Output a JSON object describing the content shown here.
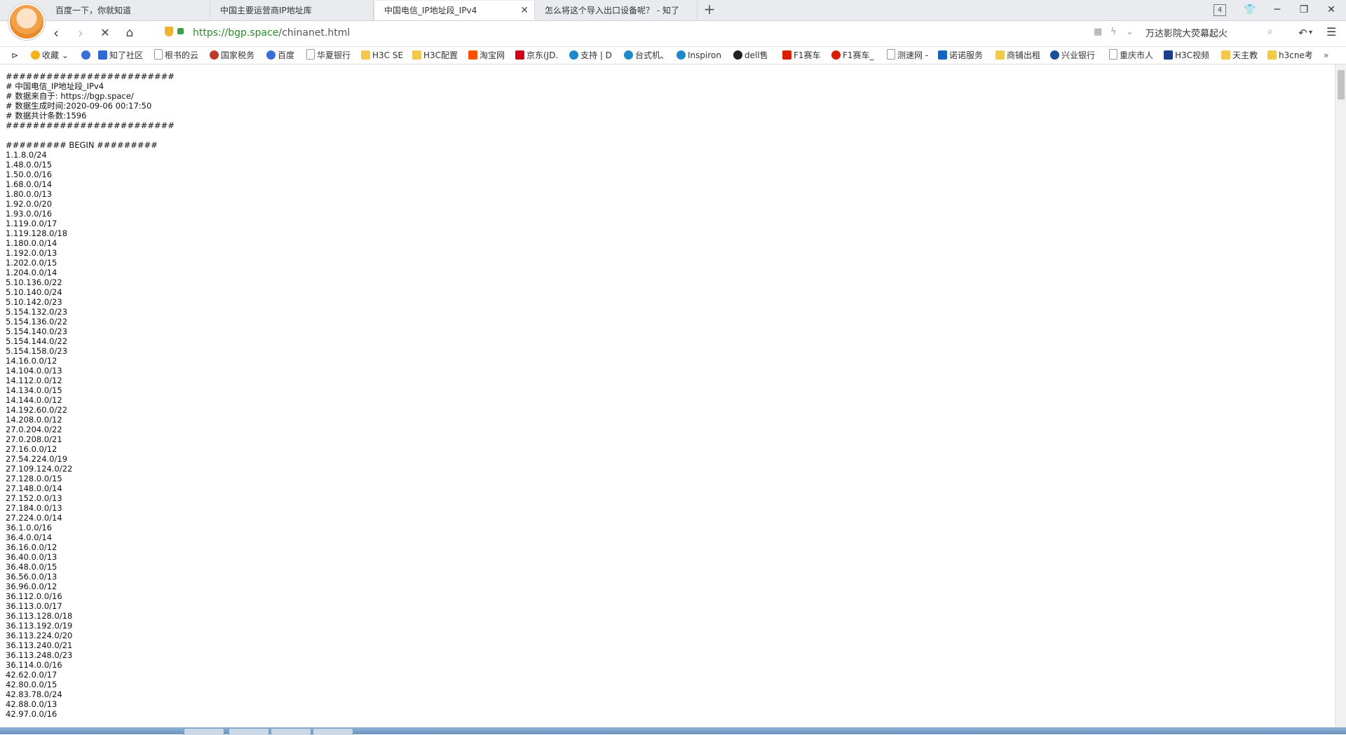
{
  "tabs": [
    {
      "label": "百度一下，你就知道",
      "active": false
    },
    {
      "label": "中国主要运营商IP地址库",
      "active": false
    },
    {
      "label": "中国电信_IP地址段_IPv4",
      "active": true
    },
    {
      "label": "怎么将这个导入出口设备呢？ - 知了",
      "active": false
    }
  ],
  "tab_count": "4",
  "address": {
    "scheme": "https://",
    "host": "bgp.space",
    "path": "/chinanet.html"
  },
  "search": {
    "value": "万达影院大荧幕起火"
  },
  "bookmarks": [
    {
      "label": "收藏",
      "icon": "star-icon",
      "color": "#f2b21b"
    },
    {
      "label": "",
      "icon": "paw-icon",
      "color": "#3a6fd8"
    },
    {
      "label": "知了社区",
      "icon": "zhiliao-icon",
      "color": "#2f6ad0"
    },
    {
      "label": "根书的云",
      "icon": "page-icon",
      "color": "#bbbbbb"
    },
    {
      "label": "国家税务",
      "icon": "tax-icon",
      "color": "#c0392b"
    },
    {
      "label": "百度",
      "icon": "paw-icon",
      "color": "#3a6fd8"
    },
    {
      "label": "华夏银行",
      "icon": "page-icon",
      "color": "#bbbbbb"
    },
    {
      "label": "H3C SE",
      "icon": "folder-icon",
      "color": "#f2c94c"
    },
    {
      "label": "H3C配置",
      "icon": "folder-icon",
      "color": "#f2c94c"
    },
    {
      "label": "淘宝网",
      "icon": "taobao-icon",
      "color": "#ff5000"
    },
    {
      "label": "京东(JD.",
      "icon": "jd-icon",
      "color": "#d0021b"
    },
    {
      "label": "支持 | D",
      "icon": "dell-icon",
      "color": "#1e88c9"
    },
    {
      "label": "台式机、",
      "icon": "dell-icon",
      "color": "#1e88c9"
    },
    {
      "label": "Inspiron",
      "icon": "dell-icon",
      "color": "#1e88c9"
    },
    {
      "label": "dell售",
      "icon": "dell-black-icon",
      "color": "#222222"
    },
    {
      "label": "F1赛车",
      "icon": "sina-icon",
      "color": "#d81e06"
    },
    {
      "label": "F1赛车_",
      "icon": "weibo-icon",
      "color": "#d81e06"
    },
    {
      "label": "测速网 -",
      "icon": "page-icon",
      "color": "#bbbbbb"
    },
    {
      "label": "诺诺服务",
      "icon": "nuonuo-icon",
      "color": "#1565c0"
    },
    {
      "label": "商铺出租",
      "icon": "folder-icon",
      "color": "#f2c94c"
    },
    {
      "label": "兴业银行",
      "icon": "cib-icon",
      "color": "#1b4f9c"
    },
    {
      "label": "重庆市人",
      "icon": "page-icon",
      "color": "#bbbbbb"
    },
    {
      "label": "H3C视频",
      "icon": "h3c-icon",
      "color": "#1b3f8c"
    },
    {
      "label": "天主教",
      "icon": "folder-icon",
      "color": "#f2c94c"
    },
    {
      "label": "h3cne考",
      "icon": "folder-icon",
      "color": "#f2c94c"
    }
  ],
  "content": {
    "header_lines": [
      "#########################",
      "# 中国电信_IP地址段_IPv4",
      "# 数据来自于: https://bgp.space/",
      "# 数据生成时间:2020-09-06 00:17:50",
      "# 数据共计条数:1596",
      "#########################"
    ],
    "begin_line": "######### BEGIN #########",
    "entries": [
      "1.1.8.0/24",
      "1.48.0.0/15",
      "1.50.0.0/16",
      "1.68.0.0/14",
      "1.80.0.0/13",
      "1.92.0.0/20",
      "1.93.0.0/16",
      "1.119.0.0/17",
      "1.119.128.0/18",
      "1.180.0.0/14",
      "1.192.0.0/13",
      "1.202.0.0/15",
      "1.204.0.0/14",
      "5.10.136.0/22",
      "5.10.140.0/24",
      "5.10.142.0/23",
      "5.154.132.0/23",
      "5.154.136.0/22",
      "5.154.140.0/23",
      "5.154.144.0/22",
      "5.154.158.0/23",
      "14.16.0.0/12",
      "14.104.0.0/13",
      "14.112.0.0/12",
      "14.134.0.0/15",
      "14.144.0.0/12",
      "14.192.60.0/22",
      "14.208.0.0/12",
      "27.0.204.0/22",
      "27.0.208.0/21",
      "27.16.0.0/12",
      "27.54.224.0/19",
      "27.109.124.0/22",
      "27.128.0.0/15",
      "27.148.0.0/14",
      "27.152.0.0/13",
      "27.184.0.0/13",
      "27.224.0.0/14",
      "36.1.0.0/16",
      "36.4.0.0/14",
      "36.16.0.0/12",
      "36.40.0.0/13",
      "36.48.0.0/15",
      "36.56.0.0/13",
      "36.96.0.0/12",
      "36.112.0.0/16",
      "36.113.0.0/17",
      "36.113.128.0/18",
      "36.113.192.0/19",
      "36.113.224.0/20",
      "36.113.240.0/21",
      "36.113.248.0/23",
      "36.114.0.0/16",
      "42.62.0.0/17",
      "42.80.0.0/15",
      "42.83.78.0/24",
      "42.88.0.0/13",
      "42.97.0.0/16"
    ]
  }
}
